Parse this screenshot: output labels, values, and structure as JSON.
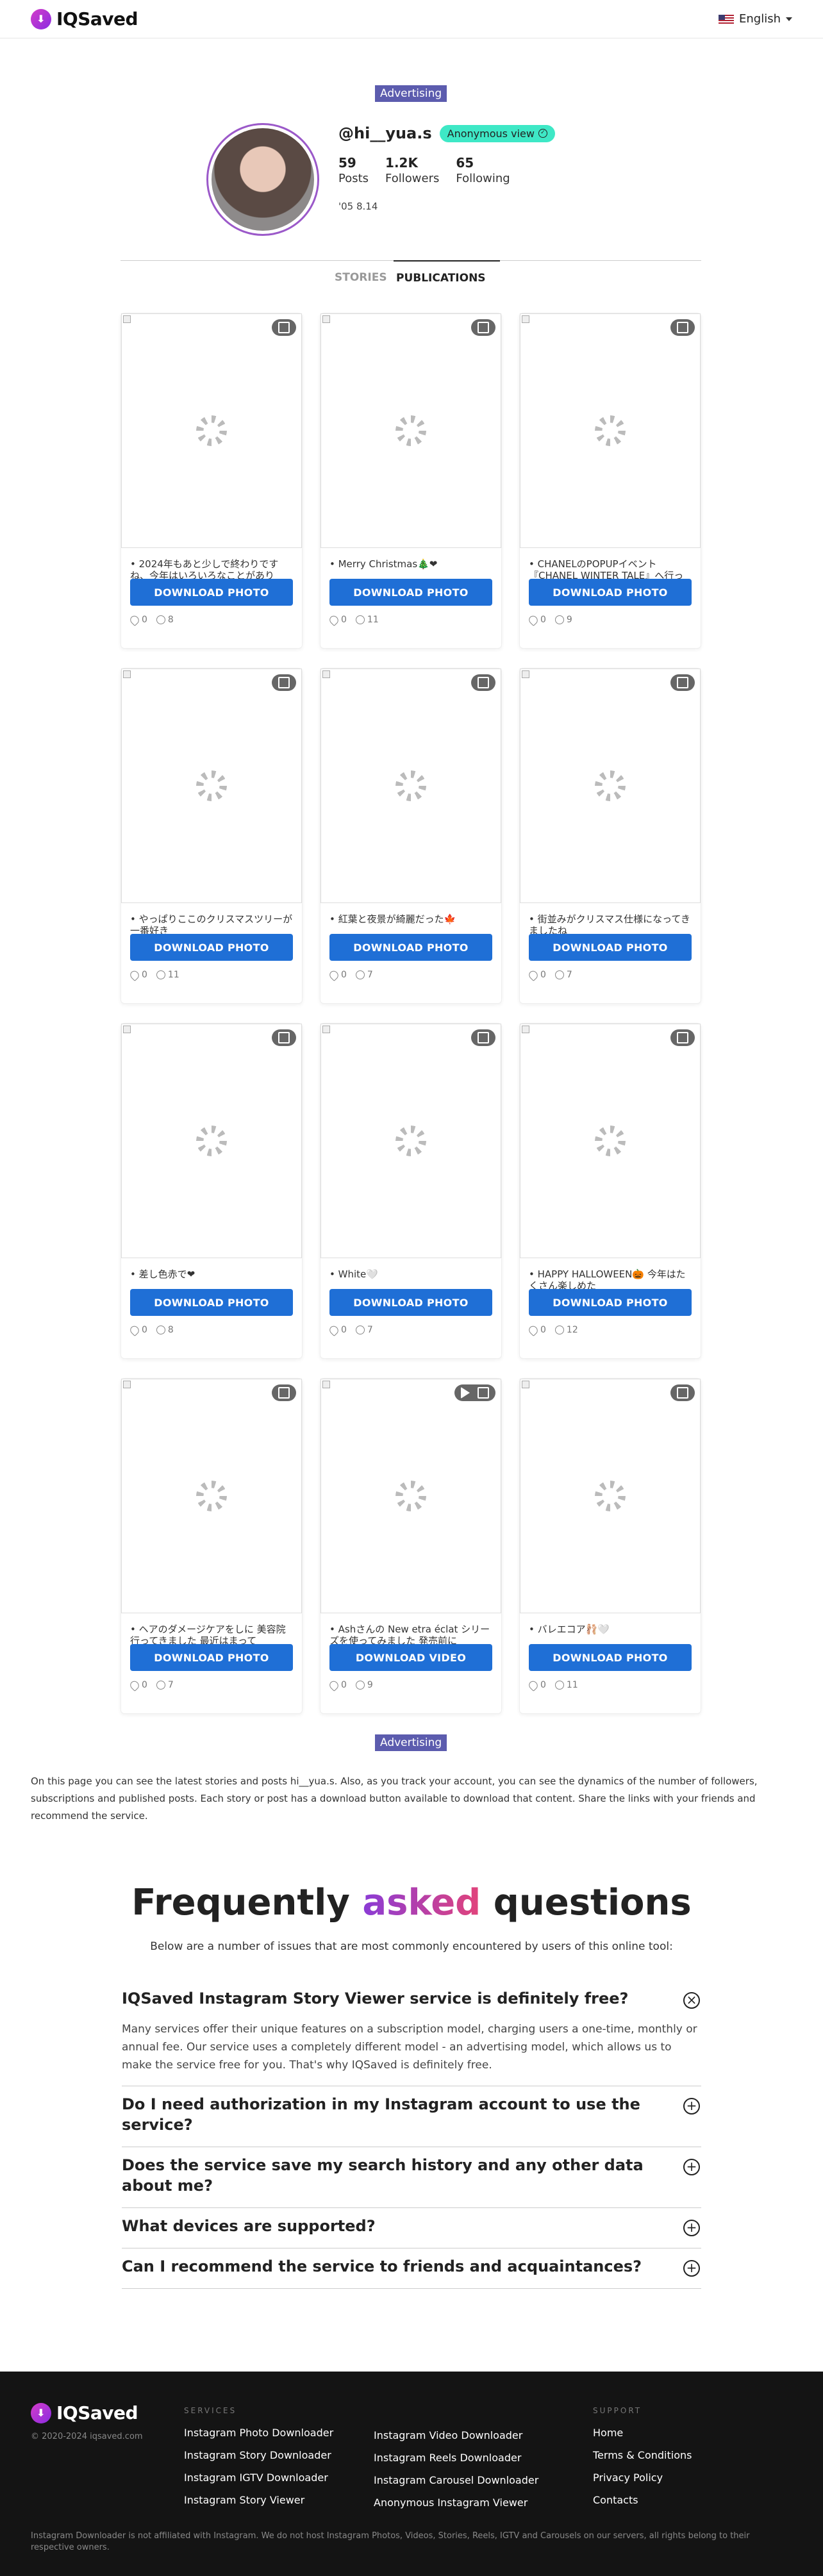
{
  "header": {
    "brand": "IQSaved",
    "language": "English"
  },
  "ad_label": "Advertising",
  "profile": {
    "username": "@hi__yua.s",
    "anon_badge": "Anonymous view",
    "stats": [
      {
        "value": "59",
        "label": "Posts"
      },
      {
        "value": "1.2K",
        "label": "Followers"
      },
      {
        "value": "65",
        "label": "Following"
      }
    ],
    "bio": "'05 8.14"
  },
  "tabs": {
    "stories": "STORIES",
    "publications": "PUBLICATIONS"
  },
  "posts": [
    {
      "caption": "• 2024年もあと少しで終わりですね、今年はいろいろなことがあり",
      "button": "DOWNLOAD PHOTO",
      "likes": "0",
      "comments": "8",
      "video": false
    },
    {
      "caption": "• Merry Christmas🎄❤",
      "button": "DOWNLOAD PHOTO",
      "likes": "0",
      "comments": "11",
      "video": false
    },
    {
      "caption": "• CHANELのPOPUPイベント『CHANEL WINTER TALE』へ行っ",
      "button": "DOWNLOAD PHOTO",
      "likes": "0",
      "comments": "9",
      "video": false
    },
    {
      "caption": "• やっぱりここのクリスマスツリーが一番好き",
      "button": "DOWNLOAD PHOTO",
      "likes": "0",
      "comments": "11",
      "video": false
    },
    {
      "caption": "• 紅葉と夜景が綺麗だった🍁",
      "button": "DOWNLOAD PHOTO",
      "likes": "0",
      "comments": "7",
      "video": false
    },
    {
      "caption": "• 街並みがクリスマス仕様になってきましたね",
      "button": "DOWNLOAD PHOTO",
      "likes": "0",
      "comments": "7",
      "video": false
    },
    {
      "caption": "• 差し色赤で❤",
      "button": "DOWNLOAD PHOTO",
      "likes": "0",
      "comments": "8",
      "video": false
    },
    {
      "caption": "• White🤍",
      "button": "DOWNLOAD PHOTO",
      "likes": "0",
      "comments": "7",
      "video": false
    },
    {
      "caption": "• HAPPY HALLOWEEN🎃 今年はたくさん楽しめた",
      "button": "DOWNLOAD PHOTO",
      "likes": "0",
      "comments": "12",
      "video": false
    },
    {
      "caption": "• ヘアのダメージケアをしに 美容院行ってきました 最近はまって",
      "button": "DOWNLOAD PHOTO",
      "likes": "0",
      "comments": "7",
      "video": false
    },
    {
      "caption": "• Ashさんの New etra éclat シリーズを使ってみました 発売前に",
      "button": "DOWNLOAD VIDEO",
      "likes": "0",
      "comments": "9",
      "video": true
    },
    {
      "caption": "• バレエコア🩰🤍",
      "button": "DOWNLOAD PHOTO",
      "likes": "0",
      "comments": "11",
      "video": false
    }
  ],
  "description": "On this page you can see the latest stories and posts hi__yua.s. Also, as you track your account, you can see the dynamics of the number of followers, subscriptions and published posts. Each story or post has a download button available to download that content. Share the links with your friends and recommend the service.",
  "faq": {
    "title_start": "Frequently ",
    "title_accent": "asked",
    "title_end": " questions",
    "subtitle": "Below are a number of issues that are most commonly encountered by users of this online tool:",
    "items": [
      {
        "q": "IQSaved Instagram Story Viewer service is definitely free?",
        "a": "Many services offer their unique features on a subscription model, charging users a one-time, monthly or annual fee. Our service uses a completely different model - an advertising model, which allows us to make the service free for you. That's why IQSaved is definitely free.",
        "open": true
      },
      {
        "q": "Do I need authorization in my Instagram account to use the service?",
        "a": "",
        "open": false
      },
      {
        "q": "Does the service save my search history and any other data about me?",
        "a": "",
        "open": false
      },
      {
        "q": "What devices are supported?",
        "a": "",
        "open": false
      },
      {
        "q": "Can I recommend the service to friends and acquaintances?",
        "a": "",
        "open": false
      }
    ]
  },
  "footer": {
    "brand": "IQSaved",
    "copyright": "© 2020-2024 iqsaved.com",
    "services_heading": "SERVICES",
    "services_col1": [
      "Instagram Photo Downloader",
      "Instagram Story Downloader",
      "Instagram IGTV Downloader",
      "Instagram Story Viewer"
    ],
    "services_col2": [
      "Instagram Video Downloader",
      "Instagram Reels Downloader",
      "Instagram Carousel Downloader",
      "Anonymous Instagram Viewer"
    ],
    "support_heading": "SUPPORT",
    "support": [
      "Home",
      "Terms & Conditions",
      "Privacy Policy",
      "Contacts"
    ],
    "disclaimer": "Instagram Downloader is not affiliated with Instagram. We do not host Instagram Photos, Videos, Stories, Reels, IGTV and Carousels on our servers, all rights belong to their respective owners."
  }
}
